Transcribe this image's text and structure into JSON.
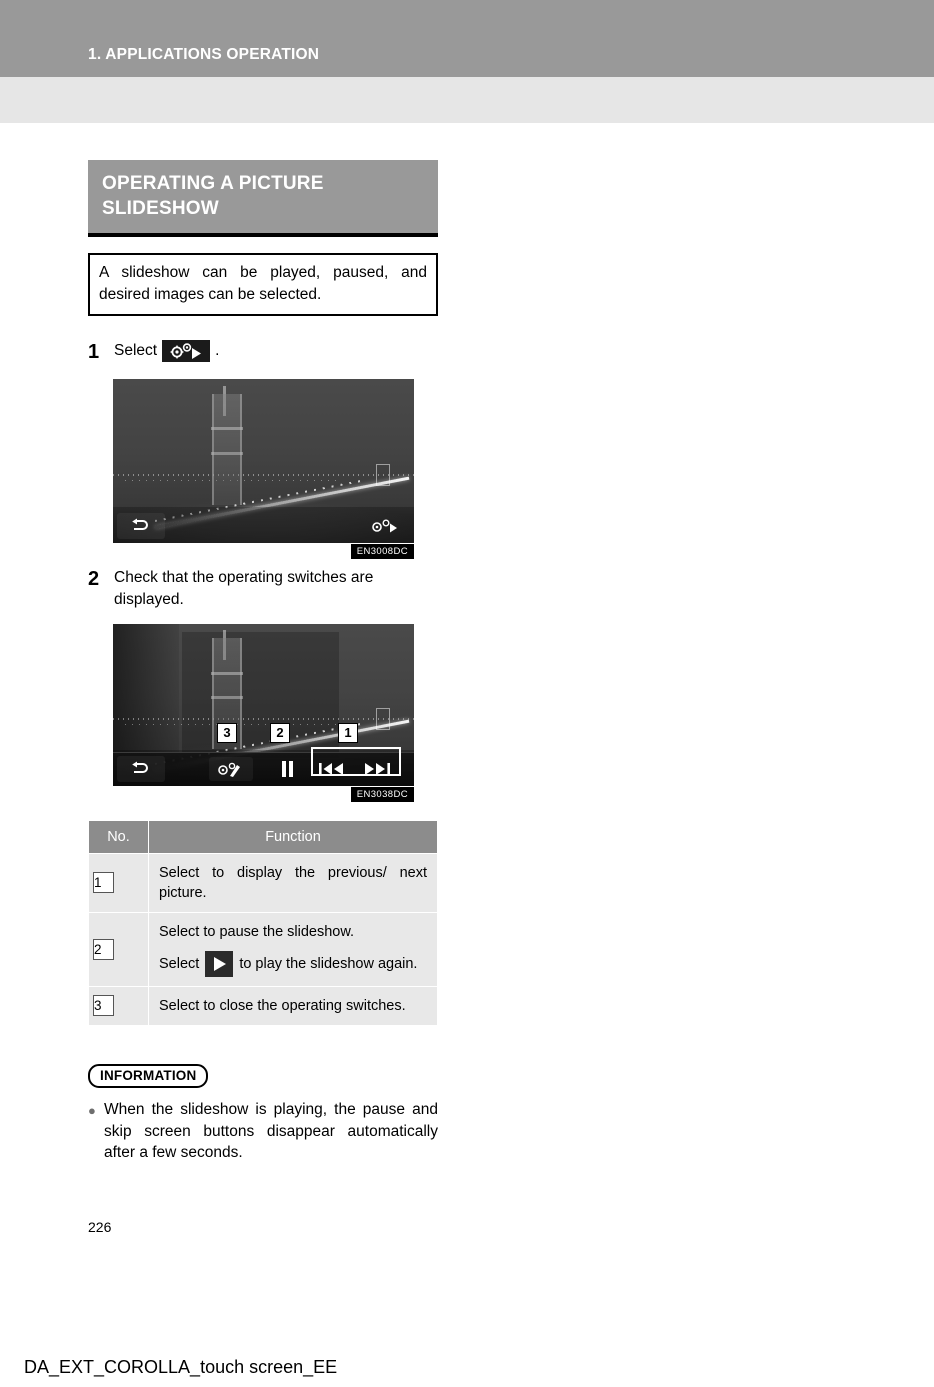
{
  "header": {
    "chapter_title": "1. APPLICATIONS OPERATION"
  },
  "section": {
    "title": "OPERATING A PICTURE SLIDESHOW",
    "description": "A slideshow can be played, paused, and desired images can be selected."
  },
  "steps": [
    {
      "number": "1",
      "text_before": "Select",
      "text_after": ".",
      "icon": "slideshow-settings-icon",
      "figure_id": "EN3008DC"
    },
    {
      "number": "2",
      "text": "Check that the operating switches are displayed.",
      "figure_id": "EN3038DC"
    }
  ],
  "screen1": {
    "back_button": "back-arrow-icon",
    "settings_button": "slideshow-settings-icon"
  },
  "screen2": {
    "back_button": "back-arrow-icon",
    "settings_button": "slideshow-settings-icon",
    "pause_button": "pause-icon",
    "previous_button": "skip-previous-icon",
    "next_button": "skip-next-icon",
    "callouts": [
      "3",
      "2",
      "1"
    ]
  },
  "table": {
    "headers": [
      "No.",
      "Function"
    ],
    "rows": [
      {
        "no": "1",
        "lines": [
          "Select to display the previous/ next picture."
        ]
      },
      {
        "no": "2",
        "lines": [
          "Select to pause the slideshow."
        ],
        "inline": {
          "before": "Select",
          "icon": "play-icon",
          "after": "to play the slideshow again."
        }
      },
      {
        "no": "3",
        "lines": [
          "Select to close the operating switches."
        ]
      }
    ]
  },
  "information": {
    "badge": "INFORMATION",
    "bullet": "●",
    "items": [
      "When the slideshow is playing, the pause and skip screen buttons disappear automatically after a few seconds."
    ]
  },
  "footer": {
    "page_number": "226",
    "document_id": "DA_EXT_COROLLA_touch screen_EE"
  },
  "colors": {
    "header_band": "#999999",
    "header_subband": "#e6e6e6",
    "section_title_bg": "#999999",
    "table_header_bg": "#8c8c8c",
    "table_cell_bg": "#e8e8e8"
  }
}
